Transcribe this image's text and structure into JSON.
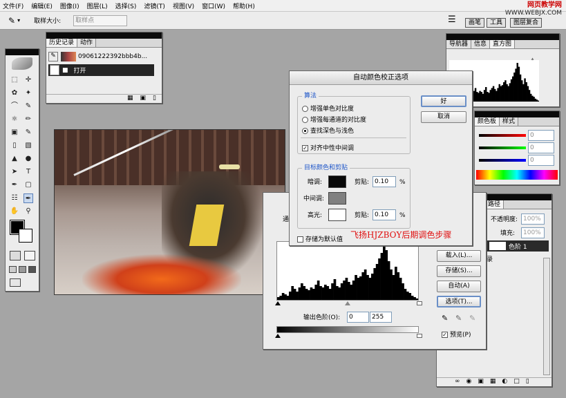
{
  "menu": [
    "文件(F)",
    "编辑(E)",
    "图像(I)",
    "图层(L)",
    "选择(S)",
    "滤镜(T)",
    "视图(V)",
    "窗口(W)",
    "帮助(H)"
  ],
  "options_bar": {
    "sample_size_label": "取样大小:",
    "sample_size_value": "取样点",
    "brushes_tab": "画笔",
    "tools_tab": "工具",
    "comps_tab": "图层复合"
  },
  "watermark": {
    "line1": "网页教学网",
    "line2": "WWW.WEBJX.COM"
  },
  "history_panel": {
    "tabs": [
      "历史记录",
      "动作"
    ],
    "snapshot": "09061222392bbb4b...",
    "step": "打开"
  },
  "navigator_panel": {
    "tabs": [
      "导航器",
      "信息",
      "直方图"
    ]
  },
  "color_panel": {
    "tabs": [
      "颜色板",
      "样式"
    ],
    "values": [
      "0",
      "0",
      "0"
    ]
  },
  "layers_panel": {
    "tabs": [
      "路径"
    ],
    "opacity_label": "不透明度:",
    "opacity": "100%",
    "fill_label": "填充:",
    "fill": "100%",
    "layer_name": "色阶 1",
    "history_hint": "录"
  },
  "auto_dialog": {
    "title": "自动颜色校正选项",
    "ok": "好",
    "cancel": "取消",
    "algorithm_group": "算法",
    "options": [
      "增强单色对比度",
      "增强每通道的对比度",
      "查找深色与浅色"
    ],
    "snap_neutral": "对齐中性中间调",
    "target_group": "目标颜色和剪贴",
    "shadows_label": "暗调:",
    "midtones_label": "中间调:",
    "highlights_label": "高光:",
    "clip_label": "剪贴:",
    "shadow_clip": "0.10",
    "highlight_clip": "0.10",
    "percent": "%",
    "save_default": "存储为默认值",
    "colors": {
      "shadow": "#080808",
      "midtone": "#808080",
      "highlight": "#ffffff"
    }
  },
  "levels_dialog": {
    "channel_label_partial": "通",
    "output_label": "输出色阶(O):",
    "output_min": "0",
    "output_max": "255",
    "buttons": [
      "载入(L)...",
      "存储(S)...",
      "自动(A)",
      "选项(T)..."
    ],
    "preview": "预览(P)",
    "histogram": [
      2,
      3,
      5,
      4,
      3,
      6,
      10,
      8,
      6,
      9,
      12,
      10,
      8,
      7,
      9,
      8,
      11,
      14,
      10,
      9,
      11,
      10,
      8,
      12,
      15,
      10,
      9,
      12,
      14,
      16,
      13,
      11,
      14,
      18,
      16,
      17,
      20,
      22,
      18,
      16,
      19,
      23,
      26,
      30,
      34,
      40,
      36,
      28,
      22,
      18,
      24,
      20,
      16,
      12,
      8,
      6,
      5,
      3,
      2,
      1
    ]
  },
  "signature": "飞扬HJZBOY后期调色步骤"
}
